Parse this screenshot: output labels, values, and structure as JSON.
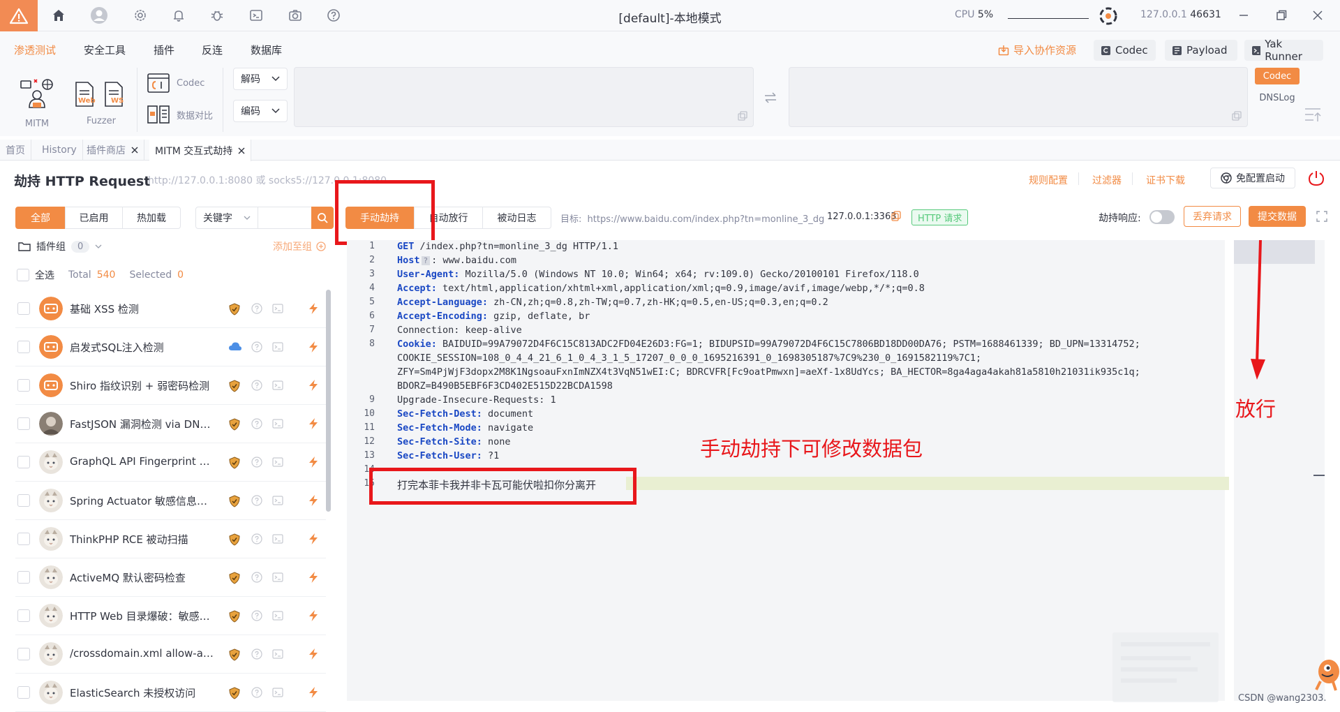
{
  "titlebar": {
    "title": "[default]-本地模式",
    "cpu_label": "CPU",
    "cpu_value": "5%",
    "address": "127.0.0.1",
    "port": "46631",
    "icons": [
      "warning-icon",
      "home-icon",
      "user-icon",
      "gear-icon",
      "bell-icon",
      "bug-icon",
      "terminal-icon",
      "camera-icon",
      "help-icon",
      "yak-logo-icon",
      "minimize-icon",
      "restore-icon",
      "close-icon"
    ]
  },
  "menu": {
    "items": [
      "渗透测试",
      "安全工具",
      "插件",
      "反连",
      "数据库"
    ],
    "import_label": "导入协作资源",
    "codec_btn": "Codec",
    "payload_btn": "Payload",
    "yakrunner_btn": "Yak Runner"
  },
  "tools": {
    "mitm_label": "MITM",
    "fuzzer_label": "Fuzzer",
    "web_tag": "Web",
    "ws_tag": "WS",
    "codec_label": "Codec",
    "compare_label": "数据对比",
    "decode_btn": "解码",
    "encode_btn": "编码",
    "side_codec": "Codec",
    "side_dnslog": "DNSLog"
  },
  "tabs": [
    {
      "label": "首页"
    },
    {
      "label": "History"
    },
    {
      "label": "插件商店"
    },
    {
      "label": "MITM 交互式劫持"
    }
  ],
  "header": {
    "title": "劫持 HTTP Request",
    "proxy": "http://127.0.0.1:8080 或 socks5://127.0.0.1:8080",
    "rules_link": "规则配置",
    "filter_link": "过滤器",
    "cert_link": "证书下载",
    "no_config_btn": "免配置启动"
  },
  "filters": {
    "all": "全部",
    "enabled": "已启用",
    "hot": "热加载",
    "keyword_select": "关键字"
  },
  "plugin_group": {
    "label": "插件组",
    "count": "0",
    "add_to_group": "添加至组",
    "select_all": "全选",
    "total_label": "Total",
    "total_value": "540",
    "selected_label": "Selected",
    "selected_value": "0"
  },
  "plugins": [
    {
      "name": "基础 XSS 检测",
      "avatar": "orange",
      "badge": "shield"
    },
    {
      "name": "启发式SQL注入检测",
      "avatar": "orange",
      "badge": "cloud"
    },
    {
      "name": "Shiro 指纹识别 + 弱密码检测",
      "avatar": "orange",
      "badge": "shield"
    },
    {
      "name": "FastJSON 漏洞检测 via DNSLog",
      "avatar": "photo",
      "badge": "shield"
    },
    {
      "name": "GraphQL API Fingerprint Chec...",
      "avatar": "cat",
      "badge": "shield"
    },
    {
      "name": "Spring Actuator 敏感信息泄漏",
      "avatar": "cat",
      "badge": "shield"
    },
    {
      "name": "ThinkPHP RCE 被动扫描",
      "avatar": "cat",
      "badge": "shield"
    },
    {
      "name": "ActiveMQ 默认密码检查",
      "avatar": "cat",
      "badge": "shield"
    },
    {
      "name": "HTTP Web 目录爆破：敏感中...",
      "avatar": "cat",
      "badge": "shield"
    },
    {
      "name": "/crossdomain.xml allow-acces...",
      "avatar": "cat",
      "badge": "shield"
    },
    {
      "name": "ElasticSearch 未授权访问",
      "avatar": "cat",
      "badge": "shield"
    }
  ],
  "mode": {
    "manual": "手动劫持",
    "auto": "自动放行",
    "passive": "被动日志",
    "target_label": "目标:",
    "target_url": "https://www.baidu.com/index.php?tn=monline_3_dg",
    "remote": "127.0.0.1:3363",
    "http_tag": "HTTP 请求",
    "hijack_response": "劫持响应:",
    "discard_btn": "丢弃请求",
    "submit_btn": "提交数据"
  },
  "request": {
    "line_numbers": [
      "1",
      "2",
      "3",
      "4",
      "5",
      "6",
      "7",
      "8",
      "",
      "",
      "",
      "9",
      "10",
      "11",
      "12",
      "13",
      "14",
      "15"
    ],
    "line1_method": "GET",
    "line1_rest": "/index.php?tn=monline_3_dg HTTP/1.1",
    "host_key": "Host",
    "host_val": ": www.baidu.com",
    "ua_key": "User-Agent:",
    "ua_val": " Mozilla/5.0 (Windows NT 10.0; Win64; x64; rv:109.0) Gecko/20100101 Firefox/118.0",
    "accept_key": "Accept:",
    "accept_val": " text/html,application/xhtml+xml,application/xml;q=0.9,image/avif,image/webp,*/*;q=0.8",
    "lang_key": "Accept-Language:",
    "lang_val": " zh-CN,zh;q=0.8,zh-TW;q=0.7,zh-HK;q=0.5,en-US;q=0.3,en;q=0.2",
    "enc_key": "Accept-Encoding:",
    "enc_val": " gzip, deflate, br",
    "conn": "Connection: keep-alive",
    "cookie_key": "Cookie:",
    "cookie_1": " BAIDUID=99A79072D4F6C15C813ADC2FD04E26D3:FG=1; BIDUPSID=99A79072D4F6C15C7806BD18DD00DA76; PSTM=1688461339; BD_UPN=13314752;",
    "cookie_2": "COOKIE_SESSION=108_0_4_4_21_6_1_0_4_3_1_5_17207_0_0_0_1695216391_0_1698305187%7C9%230_0_1691582119%7C1;",
    "cookie_3": "ZFY=Sm4PjWjF3dopx2M8K1NgsoauFxnImNZX4t3VqN51wEI:C; BDRCVFR[Fc9oatPmwxn]=aeXf-1x8UdYcs; BA_HECTOR=8ga4aga4akah81a5810h21031ik935c1q;",
    "cookie_4": "BDORZ=B490B5EBF6F3CD402E515D22BCDA1598",
    "upg": "Upgrade-Insecure-Requests: 1",
    "dest_key": "Sec-Fetch-Dest:",
    "dest_val": " document",
    "mode_key": "Sec-Fetch-Mode:",
    "mode_val": " navigate",
    "site_key": "Sec-Fetch-Site:",
    "site_val": " none",
    "user_key": "Sec-Fetch-User:",
    "user_val": " ?1",
    "body": "打完本菲卡我并非卡瓦可能伏啦扣你分离开"
  },
  "annotations": {
    "release": "放行",
    "editable_note": "手动劫持下可修改数据包"
  },
  "watermark": "CSDN @wang2303.",
  "colors": {
    "accent": "#f28b44",
    "annotation_red": "#e8171b",
    "http_tag_green": "#56c97b"
  }
}
